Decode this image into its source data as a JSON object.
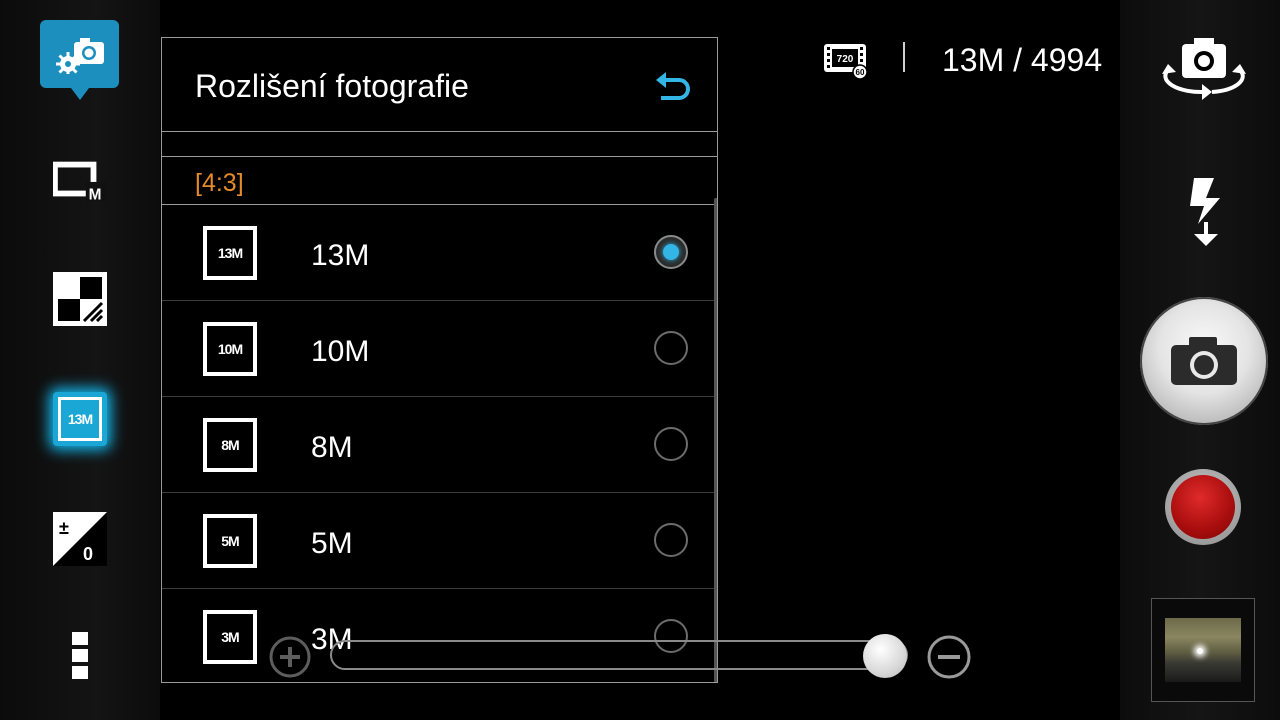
{
  "panel": {
    "title": "Rozlišení fotografie",
    "group_label": "[4:3]",
    "options": [
      {
        "label": "13M",
        "icon_text": "13M",
        "selected": true
      },
      {
        "label": "10M",
        "icon_text": "10M",
        "selected": false
      },
      {
        "label": "8M",
        "icon_text": "8M",
        "selected": false
      },
      {
        "label": "5M",
        "icon_text": "5M",
        "selected": false
      },
      {
        "label": "3M",
        "icon_text": "3M",
        "selected": false
      }
    ]
  },
  "status": {
    "video_badge": {
      "resolution": "720",
      "fps": "60"
    },
    "resolution_count": "13M / 4994"
  },
  "left_rail": {
    "active_resolution": "13M",
    "icons": [
      "camera-settings-icon",
      "mode-icon",
      "scene-icon",
      "resolution-icon",
      "exposure-icon",
      "more-icon"
    ]
  },
  "right_rail": {
    "icons": [
      "switch-camera-icon",
      "flash-auto-icon",
      "shutter-icon",
      "record-icon",
      "gallery-thumbnail"
    ]
  },
  "colors": {
    "accent": "#1aa7d6",
    "radio_selected": "#33b5e5",
    "group_label": "#e58a2a",
    "record": "#b81313"
  }
}
